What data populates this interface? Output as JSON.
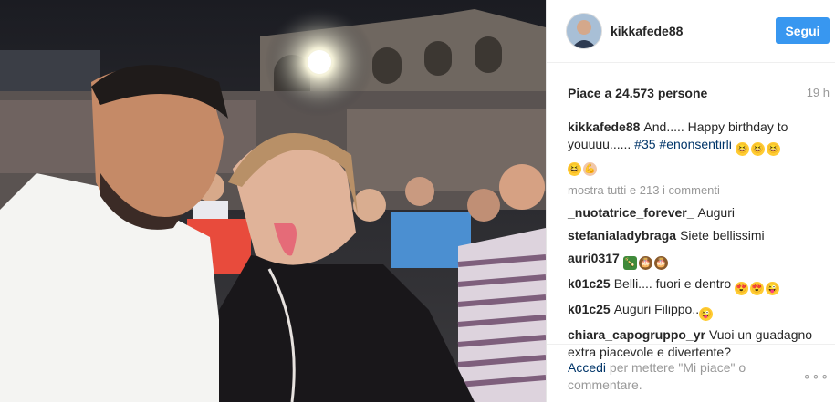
{
  "post": {
    "username": "kikkafede88",
    "follow_label": "Segui",
    "likes": "Piace a 24.573 persone",
    "time": "19 h"
  },
  "caption": {
    "user": "kikkafede88",
    "text": "And..... Happy birthday to youuuu......",
    "hashtag1": "#35",
    "hashtag2": "#enonsentirli"
  },
  "more_comments": "mostra tutti e 213 i commenti",
  "comments": [
    {
      "user": "_nuotatrice_forever_",
      "text": "Auguri"
    },
    {
      "user": "stefanialadybraga",
      "text": "Siete bellissimi"
    },
    {
      "user": "auri0317",
      "text": ""
    },
    {
      "user": "k01c25",
      "text": "Belli.... fuori e dentro"
    },
    {
      "user": "k01c25",
      "text": "Auguri Filippo.."
    },
    {
      "user": "chiara_capogruppo_yr",
      "text": "Vuoi un guadagno extra piacevole e divertente?"
    }
  ],
  "footer": {
    "login_link": "Accedi",
    "login_text": "per mettere \"Mi piace\" o commentare.",
    "options": "∘∘∘"
  },
  "icons": {
    "avatar": "profile-picture",
    "emoji_grin": "grinning-face",
    "emoji_muscle": "flexed-biceps",
    "emoji_bottle": "champagne-bottle",
    "emoji_cake": "cake",
    "emoji_heart_eyes": "heart-eyes-face",
    "emoji_wink": "face-with-tongue"
  },
  "colors": {
    "follow_button": "#3897f0",
    "link": "#003569",
    "muted": "#999999"
  }
}
